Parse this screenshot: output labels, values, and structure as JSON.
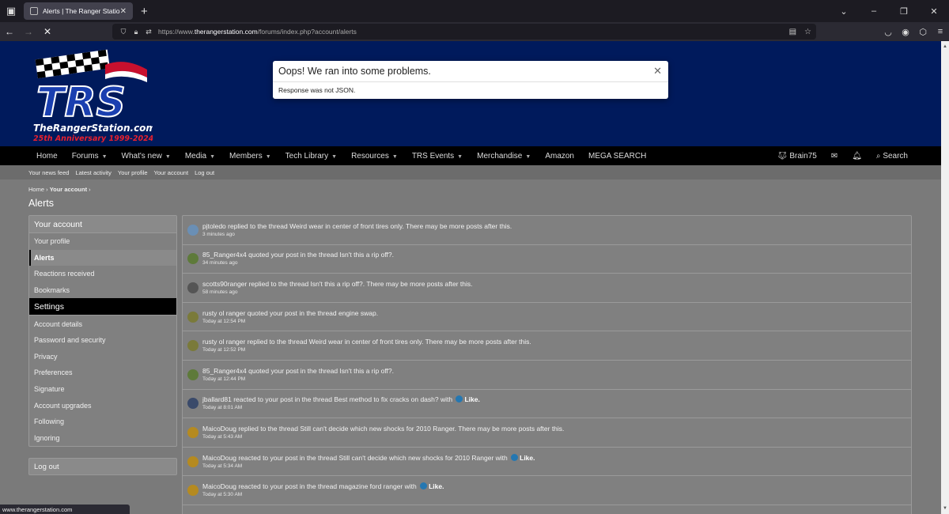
{
  "browser": {
    "tab_title": "Alerts | The Ranger Station",
    "url_prefix": "https://www.",
    "url_domain": "therangerstation.com",
    "url_path": "/forums/index.php?account/alerts",
    "status_url": "www.therangerstation.com"
  },
  "site": {
    "logo_main": "TRS",
    "logo_site": "TheRangerStation.com",
    "logo_anniv": "25th Anniversary 1999-2024"
  },
  "nav": {
    "items": [
      {
        "label": "Home",
        "dropdown": false
      },
      {
        "label": "Forums",
        "dropdown": true
      },
      {
        "label": "What's new",
        "dropdown": true
      },
      {
        "label": "Media",
        "dropdown": true
      },
      {
        "label": "Members",
        "dropdown": true
      },
      {
        "label": "Tech Library",
        "dropdown": true
      },
      {
        "label": "Resources",
        "dropdown": true
      },
      {
        "label": "TRS Events",
        "dropdown": true
      },
      {
        "label": "Merchandise",
        "dropdown": true
      },
      {
        "label": "Amazon",
        "dropdown": false
      },
      {
        "label": "MEGA SEARCH",
        "dropdown": false
      }
    ],
    "user": "Brain75",
    "search": "Search"
  },
  "subnav": [
    "Your news feed",
    "Latest activity",
    "Your profile",
    "Your account",
    "Log out"
  ],
  "breadcrumb": {
    "home": "Home",
    "current": "Your account"
  },
  "page_title": "Alerts",
  "sidebar": {
    "head1": "Your account",
    "items1": [
      "Your profile",
      "Alerts",
      "Reactions received",
      "Bookmarks"
    ],
    "head2": "Settings",
    "items2": [
      "Account details",
      "Password and security",
      "Privacy",
      "Preferences",
      "Signature",
      "Account upgrades",
      "Following",
      "Ignoring"
    ],
    "logout": "Log out"
  },
  "alerts": [
    {
      "text": "pjtoledo replied to the thread Weird wear in center of front tires only. There may be more posts after this.",
      "time": "3 minutes ago",
      "like": false,
      "avatar_color": "#6a8fb5"
    },
    {
      "text": "85_Ranger4x4 quoted your post in the thread Isn't this a rip off?.",
      "time": "34 minutes ago",
      "like": false,
      "avatar_color": "#5e7a3a"
    },
    {
      "text": "scotts90ranger replied to the thread Isn't this a rip off?. There may be more posts after this.",
      "time": "58 minutes ago",
      "like": false,
      "avatar_color": "#555555"
    },
    {
      "text": "rusty ol ranger quoted your post in the thread engine swap.",
      "time": "Today at 12:54 PM",
      "like": false,
      "avatar_color": "#7a7a3a"
    },
    {
      "text": "rusty ol ranger replied to the thread Weird wear in center of front tires only. There may be more posts after this.",
      "time": "Today at 12:52 PM",
      "like": false,
      "avatar_color": "#7a7a3a"
    },
    {
      "text": "85_Ranger4x4 quoted your post in the thread Isn't this a rip off?.",
      "time": "Today at 12:44 PM",
      "like": false,
      "avatar_color": "#5e7a3a"
    },
    {
      "text": "jballard81 reacted to your post in the thread Best method to fix cracks on dash? with",
      "time": "Today at 8:01 AM",
      "like": true,
      "avatar_color": "#3a4a6a"
    },
    {
      "text": "MaicoDoug replied to the thread Still can't decide which new shocks for 2010 Ranger. There may be more posts after this.",
      "time": "Today at 5:43 AM",
      "like": false,
      "avatar_color": "#b58a20"
    },
    {
      "text": "MaicoDoug reacted to your post in the thread Still can't decide which new shocks for 2010 Ranger with",
      "time": "Today at 5:34 AM",
      "like": true,
      "avatar_color": "#b58a20"
    },
    {
      "text": "MaicoDoug reacted to your post in the thread magazine ford ranger with",
      "time": "Today at 5:30 AM",
      "like": true,
      "avatar_color": "#b58a20"
    }
  ],
  "like_label": "Like.",
  "modal": {
    "title": "Oops! We ran into some problems.",
    "message": "Response was not JSON."
  },
  "colors": {
    "header_band": "#001a5c",
    "like": "#2577b1"
  }
}
